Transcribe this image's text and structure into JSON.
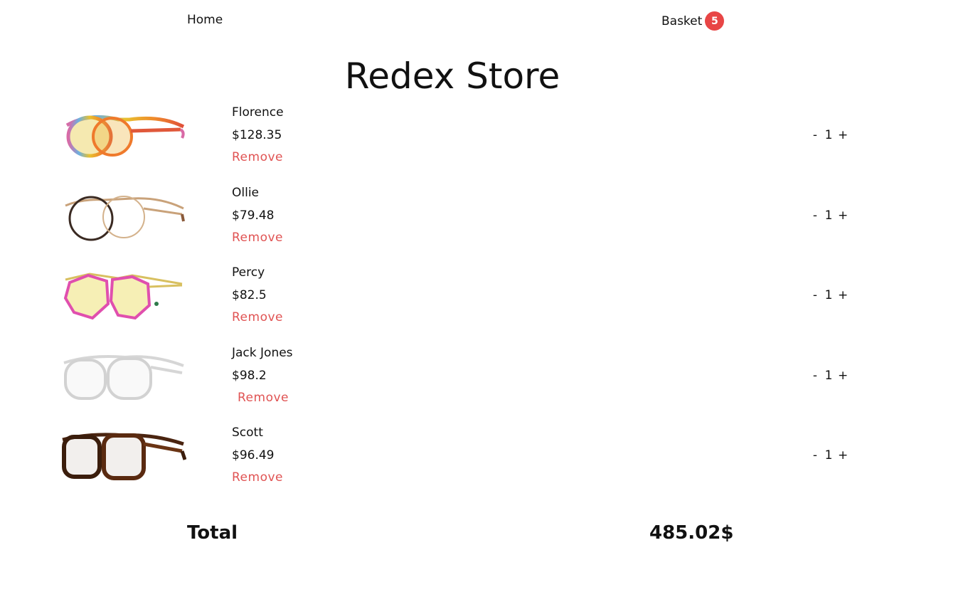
{
  "nav": {
    "home_label": "Home",
    "basket_label": "Basket",
    "basket_count": "5"
  },
  "store_title": "Redex Store",
  "cart": {
    "items": [
      {
        "name": "Florence",
        "price": "$128.35",
        "remove_label": "Remove",
        "qty": "1",
        "minus": "-",
        "plus": "+"
      },
      {
        "name": "Ollie",
        "price": "$79.48",
        "remove_label": "Remove",
        "qty": "1",
        "minus": "-",
        "plus": "+"
      },
      {
        "name": "Percy",
        "price": "$82.5",
        "remove_label": "Remove",
        "qty": "1",
        "minus": "-",
        "plus": "+"
      },
      {
        "name": "Jack Jones",
        "price": "$98.2",
        "remove_label": "Remove",
        "qty": "1",
        "minus": "-",
        "plus": "+"
      },
      {
        "name": "Scott",
        "price": "$96.49",
        "remove_label": "Remove",
        "qty": "1",
        "minus": "-",
        "plus": "+"
      }
    ],
    "total_label": "Total",
    "total_value": "485.02$"
  },
  "colors": {
    "accent": "#e84545",
    "remove": "#e05353",
    "text": "#111111",
    "background": "#ffffff"
  }
}
